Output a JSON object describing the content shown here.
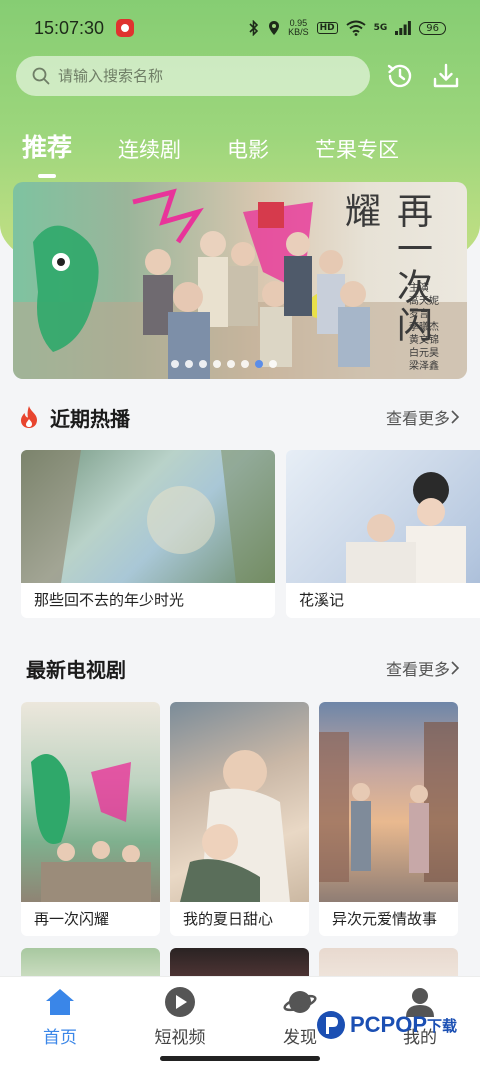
{
  "status_bar": {
    "time": "15:07:30",
    "speed": "0.95",
    "speed_unit": "KB/S",
    "hd": "HD",
    "signal": "5G",
    "battery": "96"
  },
  "search": {
    "placeholder": "请输入搜索名称"
  },
  "tabs": [
    {
      "label": "推荐",
      "active": true
    },
    {
      "label": "连续剧",
      "active": false
    },
    {
      "label": "电影",
      "active": false
    },
    {
      "label": "芒果专区",
      "active": false
    }
  ],
  "banner": {
    "title": "再一次闪耀",
    "cast_label": "主演",
    "cast": [
      "高天妮",
      "罗言",
      "李曦杰",
      "黄文锦",
      "白元昊",
      "梁泽鑫"
    ],
    "slide_count": 8,
    "active_slide": 6
  },
  "hot_section": {
    "title": "近期热播",
    "more": "查看更多",
    "items": [
      {
        "title": "那些回不去的年少时光"
      },
      {
        "title": "花溪记"
      }
    ]
  },
  "tv_section": {
    "title": "最新电视剧",
    "more": "查看更多",
    "items": [
      {
        "title": "再一次闪耀"
      },
      {
        "title": "我的夏日甜心"
      },
      {
        "title": "异次元爱情故事"
      }
    ]
  },
  "bottom_nav": [
    {
      "label": "首页",
      "icon": "home-icon",
      "active": true
    },
    {
      "label": "短视频",
      "icon": "play-icon",
      "active": false
    },
    {
      "label": "发现",
      "icon": "planet-icon",
      "active": false
    },
    {
      "label": "我的",
      "icon": "user-icon",
      "active": false
    }
  ],
  "watermark": {
    "brand": "PCPOP",
    "cn": "下载"
  },
  "colors": {
    "accent": "#3a86e8",
    "header_green": "#86cd73",
    "fire": "#e8452f"
  }
}
